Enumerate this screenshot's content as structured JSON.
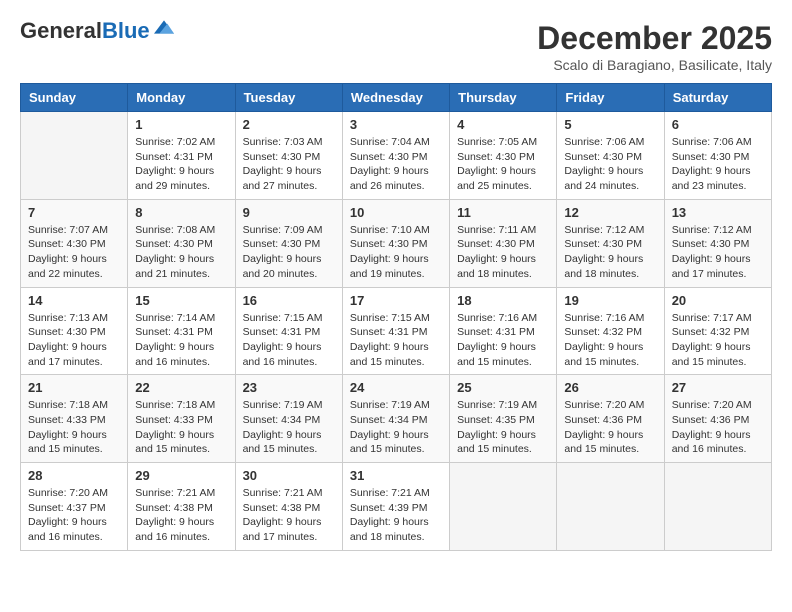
{
  "logo": {
    "text_general": "General",
    "text_blue": "Blue"
  },
  "header": {
    "month": "December 2025",
    "location": "Scalo di Baragiano, Basilicate, Italy"
  },
  "days_of_week": [
    "Sunday",
    "Monday",
    "Tuesday",
    "Wednesday",
    "Thursday",
    "Friday",
    "Saturday"
  ],
  "weeks": [
    [
      {
        "day": "",
        "info": ""
      },
      {
        "day": "1",
        "info": "Sunrise: 7:02 AM\nSunset: 4:31 PM\nDaylight: 9 hours\nand 29 minutes."
      },
      {
        "day": "2",
        "info": "Sunrise: 7:03 AM\nSunset: 4:30 PM\nDaylight: 9 hours\nand 27 minutes."
      },
      {
        "day": "3",
        "info": "Sunrise: 7:04 AM\nSunset: 4:30 PM\nDaylight: 9 hours\nand 26 minutes."
      },
      {
        "day": "4",
        "info": "Sunrise: 7:05 AM\nSunset: 4:30 PM\nDaylight: 9 hours\nand 25 minutes."
      },
      {
        "day": "5",
        "info": "Sunrise: 7:06 AM\nSunset: 4:30 PM\nDaylight: 9 hours\nand 24 minutes."
      },
      {
        "day": "6",
        "info": "Sunrise: 7:06 AM\nSunset: 4:30 PM\nDaylight: 9 hours\nand 23 minutes."
      }
    ],
    [
      {
        "day": "7",
        "info": "Sunrise: 7:07 AM\nSunset: 4:30 PM\nDaylight: 9 hours\nand 22 minutes."
      },
      {
        "day": "8",
        "info": "Sunrise: 7:08 AM\nSunset: 4:30 PM\nDaylight: 9 hours\nand 21 minutes."
      },
      {
        "day": "9",
        "info": "Sunrise: 7:09 AM\nSunset: 4:30 PM\nDaylight: 9 hours\nand 20 minutes."
      },
      {
        "day": "10",
        "info": "Sunrise: 7:10 AM\nSunset: 4:30 PM\nDaylight: 9 hours\nand 19 minutes."
      },
      {
        "day": "11",
        "info": "Sunrise: 7:11 AM\nSunset: 4:30 PM\nDaylight: 9 hours\nand 18 minutes."
      },
      {
        "day": "12",
        "info": "Sunrise: 7:12 AM\nSunset: 4:30 PM\nDaylight: 9 hours\nand 18 minutes."
      },
      {
        "day": "13",
        "info": "Sunrise: 7:12 AM\nSunset: 4:30 PM\nDaylight: 9 hours\nand 17 minutes."
      }
    ],
    [
      {
        "day": "14",
        "info": "Sunrise: 7:13 AM\nSunset: 4:30 PM\nDaylight: 9 hours\nand 17 minutes."
      },
      {
        "day": "15",
        "info": "Sunrise: 7:14 AM\nSunset: 4:31 PM\nDaylight: 9 hours\nand 16 minutes."
      },
      {
        "day": "16",
        "info": "Sunrise: 7:15 AM\nSunset: 4:31 PM\nDaylight: 9 hours\nand 16 minutes."
      },
      {
        "day": "17",
        "info": "Sunrise: 7:15 AM\nSunset: 4:31 PM\nDaylight: 9 hours\nand 15 minutes."
      },
      {
        "day": "18",
        "info": "Sunrise: 7:16 AM\nSunset: 4:31 PM\nDaylight: 9 hours\nand 15 minutes."
      },
      {
        "day": "19",
        "info": "Sunrise: 7:16 AM\nSunset: 4:32 PM\nDaylight: 9 hours\nand 15 minutes."
      },
      {
        "day": "20",
        "info": "Sunrise: 7:17 AM\nSunset: 4:32 PM\nDaylight: 9 hours\nand 15 minutes."
      }
    ],
    [
      {
        "day": "21",
        "info": "Sunrise: 7:18 AM\nSunset: 4:33 PM\nDaylight: 9 hours\nand 15 minutes."
      },
      {
        "day": "22",
        "info": "Sunrise: 7:18 AM\nSunset: 4:33 PM\nDaylight: 9 hours\nand 15 minutes."
      },
      {
        "day": "23",
        "info": "Sunrise: 7:19 AM\nSunset: 4:34 PM\nDaylight: 9 hours\nand 15 minutes."
      },
      {
        "day": "24",
        "info": "Sunrise: 7:19 AM\nSunset: 4:34 PM\nDaylight: 9 hours\nand 15 minutes."
      },
      {
        "day": "25",
        "info": "Sunrise: 7:19 AM\nSunset: 4:35 PM\nDaylight: 9 hours\nand 15 minutes."
      },
      {
        "day": "26",
        "info": "Sunrise: 7:20 AM\nSunset: 4:36 PM\nDaylight: 9 hours\nand 15 minutes."
      },
      {
        "day": "27",
        "info": "Sunrise: 7:20 AM\nSunset: 4:36 PM\nDaylight: 9 hours\nand 16 minutes."
      }
    ],
    [
      {
        "day": "28",
        "info": "Sunrise: 7:20 AM\nSunset: 4:37 PM\nDaylight: 9 hours\nand 16 minutes."
      },
      {
        "day": "29",
        "info": "Sunrise: 7:21 AM\nSunset: 4:38 PM\nDaylight: 9 hours\nand 16 minutes."
      },
      {
        "day": "30",
        "info": "Sunrise: 7:21 AM\nSunset: 4:38 PM\nDaylight: 9 hours\nand 17 minutes."
      },
      {
        "day": "31",
        "info": "Sunrise: 7:21 AM\nSunset: 4:39 PM\nDaylight: 9 hours\nand 18 minutes."
      },
      {
        "day": "",
        "info": ""
      },
      {
        "day": "",
        "info": ""
      },
      {
        "day": "",
        "info": ""
      }
    ]
  ]
}
